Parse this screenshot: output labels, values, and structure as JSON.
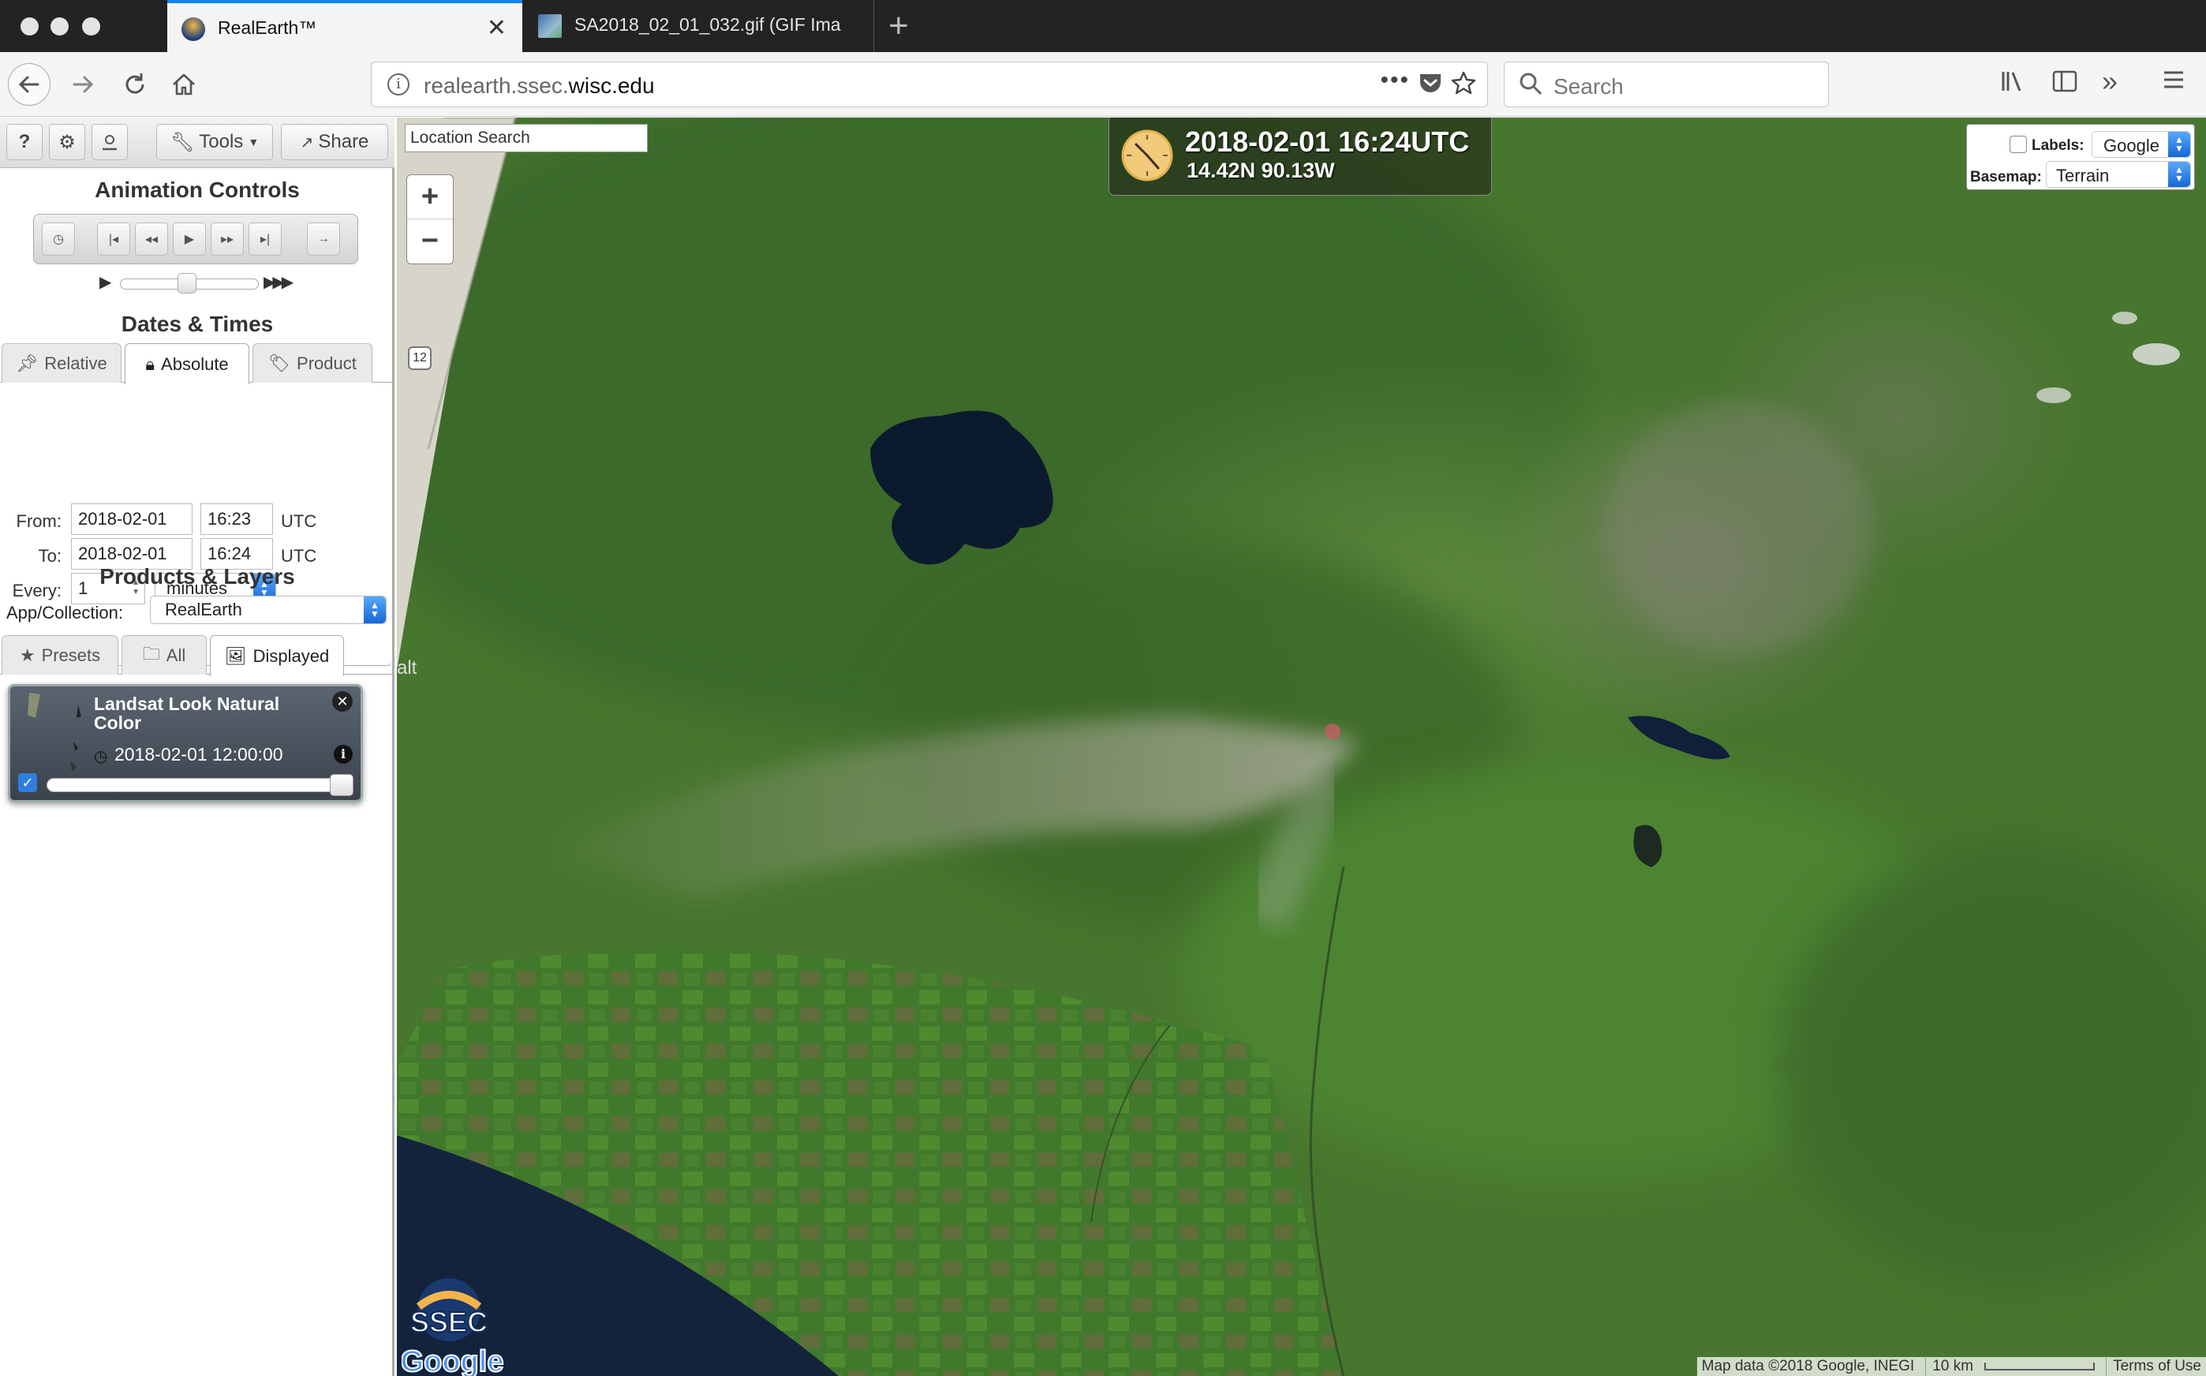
{
  "browser": {
    "tabs": [
      {
        "title": "RealEarth™",
        "active": true
      },
      {
        "title": "SA2018_02_01_032.gif (GIF Ima",
        "active": false
      }
    ],
    "url_prefix": "realearth.ssec.",
    "url_domain": "wisc.edu",
    "search_placeholder": "Search"
  },
  "sidebar": {
    "toolbar": {
      "help": "?",
      "tools_label": "Tools",
      "share_label": "Share"
    },
    "animation": {
      "title": "Animation Controls"
    },
    "dates": {
      "title": "Dates & Times",
      "tabs": [
        "Relative",
        "Absolute",
        "Product"
      ],
      "active_tab": "Absolute",
      "from_label": "From:",
      "from_date": "2018-02-01",
      "from_time": "16:23",
      "to_label": "To:",
      "to_date": "2018-02-01",
      "to_time": "16:24",
      "tz": "UTC",
      "every_label": "Every:",
      "every_value": "1",
      "every_unit": "minutes"
    },
    "products": {
      "title": "Products & Layers",
      "collection_label": "App/Collection:",
      "collection_value": "RealEarth",
      "tabs": [
        "Presets",
        "All",
        "Displayed"
      ],
      "active_tab": "Displayed",
      "layer_name": "Landsat Look Natural Color",
      "layer_time": "2018-02-01 12:00:00",
      "layer_enabled": true,
      "layer_opacity": 1.0
    }
  },
  "map": {
    "location_search_placeholder": "Location Search",
    "zoom_in": "+",
    "zoom_out": "−",
    "clock_datetime": "2018-02-01 16:24UTC",
    "clock_coords": "14.42N 90.13W",
    "labels_label": "Labels:",
    "labels_value": "Google",
    "labels_enabled": false,
    "basemap_label": "Basemap:",
    "basemap_value": "Terrain",
    "road_shield": "12",
    "edge_text": "alt",
    "attribution": "Map data ©2018 Google, INEGI",
    "scale_label": "10 km",
    "terms": "Terms of Use",
    "logo_text_1": "SSEC",
    "logo_text_2": "Google"
  }
}
